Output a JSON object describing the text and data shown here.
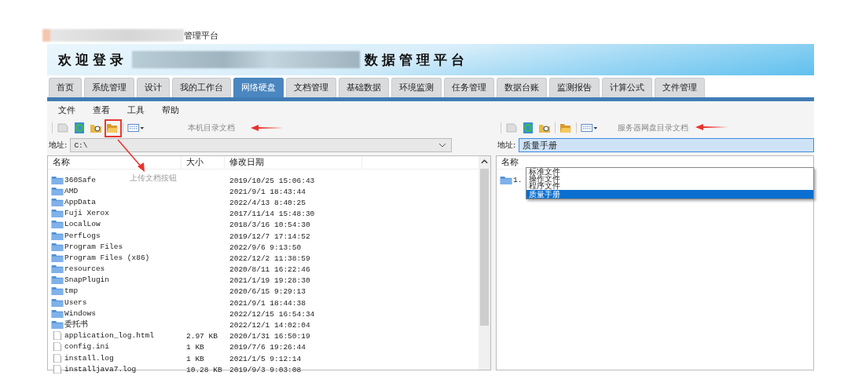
{
  "page_title": "管理平台",
  "banner": {
    "welcome": "欢迎登录",
    "platform": "数据管理平台"
  },
  "tabs": [
    {
      "label": "首页",
      "selected": false
    },
    {
      "label": "系统管理",
      "selected": false
    },
    {
      "label": "设计",
      "selected": false
    },
    {
      "label": "我的工作台",
      "selected": false
    },
    {
      "label": "网络硬盘",
      "selected": true
    },
    {
      "label": "文档管理",
      "selected": false
    },
    {
      "label": "基础数据",
      "selected": false
    },
    {
      "label": "环境监测",
      "selected": false
    },
    {
      "label": "任务管理",
      "selected": false
    },
    {
      "label": "数据台账",
      "selected": false
    },
    {
      "label": "监测报告",
      "selected": false
    },
    {
      "label": "计算公式",
      "selected": false
    },
    {
      "label": "文件管理",
      "selected": false
    }
  ],
  "menu": [
    "文件",
    "查看",
    "工具",
    "帮助"
  ],
  "local_pane": {
    "caption": "本机目录文档",
    "address_label": "地址:",
    "address": "C:\\",
    "columns": [
      "名称",
      "大小",
      "修改日期"
    ],
    "rows": [
      {
        "kind": "folder",
        "name": "360Safe",
        "size": "",
        "modified": "2019/10/25 15:06:43"
      },
      {
        "kind": "folder",
        "name": "AMD",
        "size": "",
        "modified": "2021/9/1 18:43:44"
      },
      {
        "kind": "folder",
        "name": "AppData",
        "size": "",
        "modified": "2022/4/13 8:40:25"
      },
      {
        "kind": "folder",
        "name": "Fuji Xerox",
        "size": "",
        "modified": "2017/11/14 15:48:30"
      },
      {
        "kind": "folder",
        "name": "LocalLow",
        "size": "",
        "modified": "2018/3/16 10:54:30"
      },
      {
        "kind": "folder",
        "name": "PerfLogs",
        "size": "",
        "modified": "2019/12/7 17:14:52"
      },
      {
        "kind": "folder",
        "name": "Program Files",
        "size": "",
        "modified": "2022/9/6 9:13:50"
      },
      {
        "kind": "folder",
        "name": "Program Files (x86)",
        "size": "",
        "modified": "2022/12/2 11:38:59"
      },
      {
        "kind": "folder",
        "name": "resources",
        "size": "",
        "modified": "2020/8/11 16:22:46"
      },
      {
        "kind": "folder",
        "name": "SnapPlugin",
        "size": "",
        "modified": "2021/1/19 19:28:30"
      },
      {
        "kind": "folder",
        "name": "tmp",
        "size": "",
        "modified": "2020/6/15 9:29:13"
      },
      {
        "kind": "folder",
        "name": "Users",
        "size": "",
        "modified": "2021/9/1 18:44:38"
      },
      {
        "kind": "folder",
        "name": "Windows",
        "size": "",
        "modified": "2022/12/15 16:54:34"
      },
      {
        "kind": "folder",
        "name": "委托书",
        "size": "",
        "modified": "2022/12/1 14:02:04"
      },
      {
        "kind": "file",
        "name": "application_log.html",
        "size": "2.97 KB",
        "modified": "2020/1/31 16:50:19"
      },
      {
        "kind": "file",
        "name": "config.ini",
        "size": "1 KB",
        "modified": "2019/7/6 19:26:44"
      },
      {
        "kind": "file",
        "name": "install.log",
        "size": "1 KB",
        "modified": "2021/1/5 9:12:14"
      },
      {
        "kind": "file",
        "name": "installjava7.log",
        "size": "10.28 KB",
        "modified": "2019/9/3 9:03:08"
      }
    ]
  },
  "server_pane": {
    "caption": "服务器网盘目录文档",
    "address_label": "地址:",
    "address": "质量手册",
    "columns": [
      "名称"
    ],
    "rows": [
      {
        "kind": "folder",
        "name": "1."
      }
    ],
    "dropdown": [
      {
        "label": "标准文件",
        "selected": false
      },
      {
        "label": "操作文件",
        "selected": false
      },
      {
        "label": "程序文件",
        "selected": false
      },
      {
        "label": "质量手册",
        "selected": true
      }
    ]
  },
  "annotation": "上传文档按钮"
}
